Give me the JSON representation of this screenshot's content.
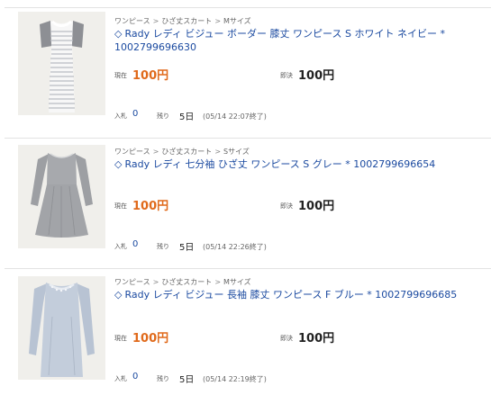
{
  "listings": [
    {
      "breadcrumb": [
        "ワンピース",
        "ひざ丈スカート",
        "Mサイズ"
      ],
      "breadcrumb_sep": ">",
      "title_marker": "◇",
      "title": "Rady レディ ビジュー ボーダー 膝丈 ワンピース S ホワイト ネイビー * 1002799696630",
      "current_label": "現在",
      "current_price": "100円",
      "buyout_label": "即決",
      "buyout_price": "100円",
      "bids_label": "入札",
      "bids": "0",
      "remaining_label": "残り",
      "remaining": "5日",
      "end_time": "(05/14 22:07終了)",
      "image": "white-navy-striped-dress"
    },
    {
      "breadcrumb": [
        "ワンピース",
        "ひざ丈スカート",
        "Sサイズ"
      ],
      "breadcrumb_sep": ">",
      "title_marker": "◇",
      "title": "Rady レディ 七分袖 ひざ丈 ワンピース S グレー * 1002799696654",
      "current_label": "現在",
      "current_price": "100円",
      "buyout_label": "即決",
      "buyout_price": "100円",
      "bids_label": "入札",
      "bids": "0",
      "remaining_label": "残り",
      "remaining": "5日",
      "end_time": "(05/14 22:26終了)",
      "image": "grey-flared-dress"
    },
    {
      "breadcrumb": [
        "ワンピース",
        "ひざ丈スカート",
        "Mサイズ"
      ],
      "breadcrumb_sep": ">",
      "title_marker": "◇",
      "title": "Rady レディ ビジュー 長袖 膝丈 ワンピース F ブルー * 1002799696685",
      "current_label": "現在",
      "current_price": "100円",
      "buyout_label": "即決",
      "buyout_price": "100円",
      "bids_label": "入札",
      "bids": "0",
      "remaining_label": "残り",
      "remaining": "5日",
      "end_time": "(05/14 22:19終了)",
      "image": "light-blue-longsleeve-dress"
    }
  ],
  "colors": {
    "link": "#1b4aa0",
    "current_price": "#e06a1b",
    "buyout_price": "#222222"
  }
}
